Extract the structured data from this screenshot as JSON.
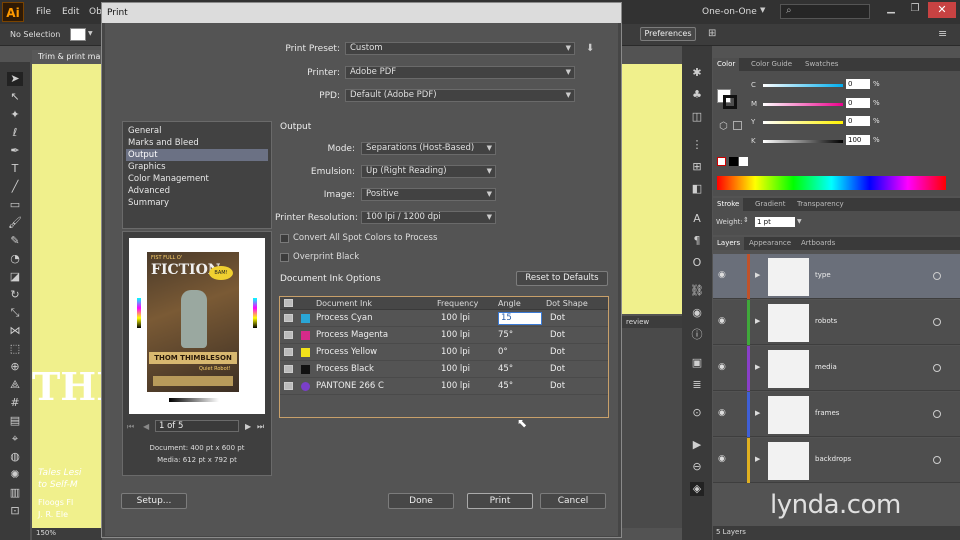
{
  "app": {
    "logo": "Ai",
    "menus": [
      "File",
      "Edit",
      "Ob"
    ],
    "workspace": "One-on-One",
    "selection_label": "No Selection",
    "preferences_label": "Preferences",
    "doc_tab": "Trim & print ma",
    "zoom": "150%",
    "art_text": {
      "big": "THI",
      "line1": "Tales Lesi",
      "line2": "to Self-M",
      "line3": "Floogs Fl",
      "line4": "J. R. Ele"
    },
    "viewer_tab": "review"
  },
  "dialog": {
    "title": "Print",
    "print_preset_label": "Print Preset:",
    "print_preset": "Custom",
    "printer_label": "Printer:",
    "printer": "Adobe PDF",
    "ppd_label": "PPD:",
    "ppd": "Default (Adobe PDF)",
    "categories": [
      "General",
      "Marks and Bleed",
      "Output",
      "Graphics",
      "Color Management",
      "Advanced",
      "Summary"
    ],
    "selected_category": "Output",
    "section_title": "Output",
    "mode_label": "Mode:",
    "mode": "Separations (Host-Based)",
    "emulsion_label": "Emulsion:",
    "emulsion": "Up (Right Reading)",
    "image_label": "Image:",
    "image": "Positive",
    "resolution_label": "Printer Resolution:",
    "resolution": "100 lpi / 1200 dpi",
    "convert_spot_label": "Convert All Spot Colors to Process",
    "convert_spot_checked": false,
    "overprint_black_label": "Overprint Black",
    "overprint_black_checked": false,
    "ink_options_label": "Document Ink Options",
    "reset_label": "Reset to Defaults",
    "ink_headers": [
      "Document Ink",
      "Frequency",
      "Angle",
      "Dot Shape"
    ],
    "inks": [
      {
        "name": "Process Cyan",
        "frequency": "100 lpi",
        "angle": "15",
        "dot": "Dot",
        "color": "#2aa6d6"
      },
      {
        "name": "Process Magenta",
        "frequency": "100 lpi",
        "angle": "75°",
        "dot": "Dot",
        "color": "#d62a8a"
      },
      {
        "name": "Process Yellow",
        "frequency": "100 lpi",
        "angle": "0°",
        "dot": "Dot",
        "color": "#f2e21a"
      },
      {
        "name": "Process Black",
        "frequency": "100 lpi",
        "angle": "45°",
        "dot": "Dot",
        "color": "#111111"
      },
      {
        "name": "PANTONE 266 C",
        "frequency": "100 lpi",
        "angle": "45°",
        "dot": "Dot",
        "color": "#7a3fc9"
      }
    ],
    "preview_page": "1 of 5",
    "document_size": "Document: 400 pt x 600 pt",
    "media_size": "Media: 612 pt x 792 pt",
    "preview_art": {
      "title_top": "FIST FULL O'",
      "title": "FICTION",
      "badge": "BAM!",
      "author": "THOM THIMBLESON",
      "tagline": "Quiet Robot!"
    },
    "setup_label": "Setup...",
    "done_label": "Done",
    "print_label": "Print",
    "cancel_label": "Cancel"
  },
  "color_panel": {
    "tabs": [
      "Color",
      "Color Guide",
      "Swatches"
    ],
    "channels": [
      {
        "label": "C",
        "value": "0"
      },
      {
        "label": "M",
        "value": "0"
      },
      {
        "label": "Y",
        "value": "0"
      },
      {
        "label": "K",
        "value": "100"
      }
    ],
    "unit": "%"
  },
  "stroke_panel": {
    "tabs": [
      "Stroke",
      "Gradient",
      "Transparency"
    ],
    "weight_label": "Weight:",
    "weight": "1 pt"
  },
  "layers_panel": {
    "tabs": [
      "Layers",
      "Appearance",
      "Artboards"
    ],
    "layers": [
      {
        "name": "type",
        "color": "#c0522a"
      },
      {
        "name": "robots",
        "color": "#3fa83a"
      },
      {
        "name": "media",
        "color": "#8a3fc9"
      },
      {
        "name": "frames",
        "color": "#3f5fd6"
      },
      {
        "name": "backdrops",
        "color": "#e0b020"
      }
    ],
    "count_label": "5 Layers"
  },
  "watermark": "lynda.com"
}
